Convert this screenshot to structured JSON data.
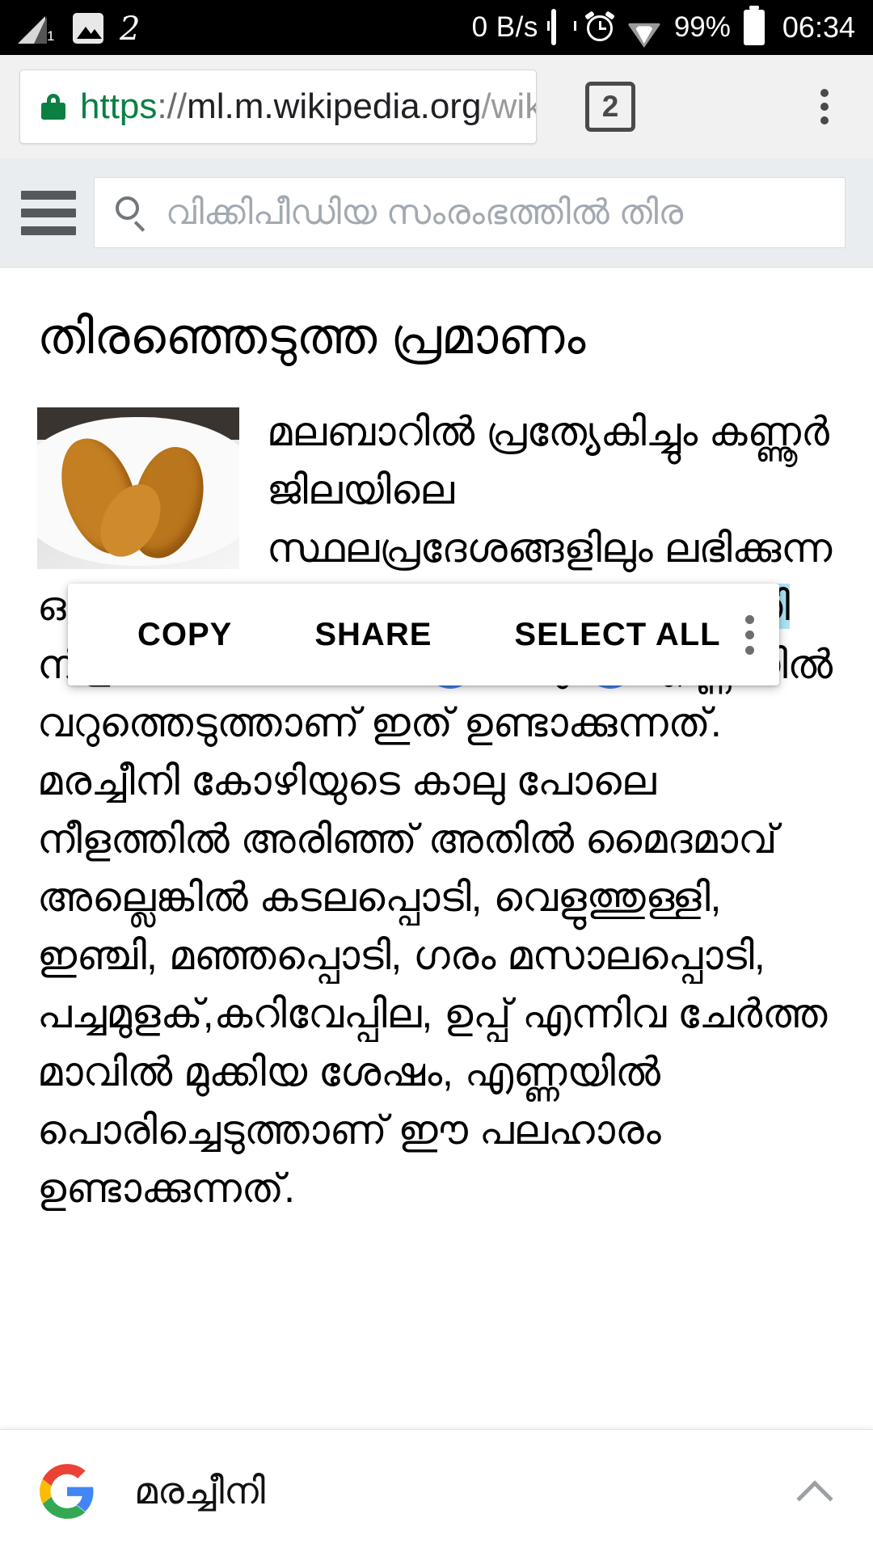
{
  "status_bar": {
    "signal_label": "1",
    "signal_icon": "signal-bars-icon",
    "photo_icon": "image-icon",
    "glyph_icon": "2",
    "network_speed": "0 B/s",
    "vibrate_icon": "vibrate-icon",
    "alarm_icon": "alarm-clock-icon",
    "wifi_icon": "wifi-icon",
    "battery_percent": "99%",
    "battery_icon": "battery-full-icon",
    "clock": "06:34"
  },
  "browser": {
    "lock_icon": "lock-icon",
    "url_scheme": "https",
    "url_separator": "://",
    "url_host": "ml.m.wikipedia.org",
    "url_path": "/wik",
    "tab_count": "2",
    "menu_icon": "overflow-menu-icon"
  },
  "wiki_header": {
    "menu_icon": "hamburger-menu-icon",
    "search_icon": "search-icon",
    "search_placeholder": "വിക്കിപീഡിയ സംരംഭത്തിൽ തിര"
  },
  "article": {
    "title": "തിരഞ്ഞെടുത്ത പ്രമാണം",
    "thumbnail_alt": "fried-snack-photo",
    "body_html": "മലബാറിൽ പ്രത്യേകിച്ചും കണ്ണൂർ ജിലയിലെ സ്ഥലപ്രദേശങ്ങളിലും ലഭിക്കുന്ന ഒരു പലഹാരമാണ് കോഴിക്കാൽ. <sel>മരച്ചീനി</sel> നീളത്തിൽ കീറി മൈദയിൽ മുക്കി എണ്ണയിൽ വറുത്തെടുത്താണ് ഇത് ഉണ്ടാക്കുന്നത്. മരച്ചീനി കോഴിയുടെ കാലു പോലെ നീളത്തിൽ അരിഞ്ഞ് അതിൽ മൈദമാവ് അല്ലെങ്കിൽ കടലപ്പൊടി, വെളുത്തുള്ളി, ഇഞ്ചി, മഞ്ഞപ്പൊടി, ഗരം മസാലപ്പൊടി, പച്ചമുളക്,കറിവേപ്പില, ഉപ്പ് എന്നിവ ചേർത്ത മാവിൽ മുക്കിയ ശേഷം, എണ്ണയിൽ പൊരിച്ചെടുത്താണ് ഈ പലഹാരം ഉണ്ടാക്കുന്നത്.",
    "selected_text": "മരച്ചീനി",
    "selection_color": "#ade4f4",
    "handle_color": "#4285f4"
  },
  "context_menu": {
    "copy": "COPY",
    "share": "SHARE",
    "select_all": "SELECT ALL",
    "more_icon": "overflow-menu-icon"
  },
  "bottom_bar": {
    "logo_icon": "google-logo-icon",
    "query": "മരച്ചീനി",
    "expand_icon": "chevron-up-icon"
  }
}
